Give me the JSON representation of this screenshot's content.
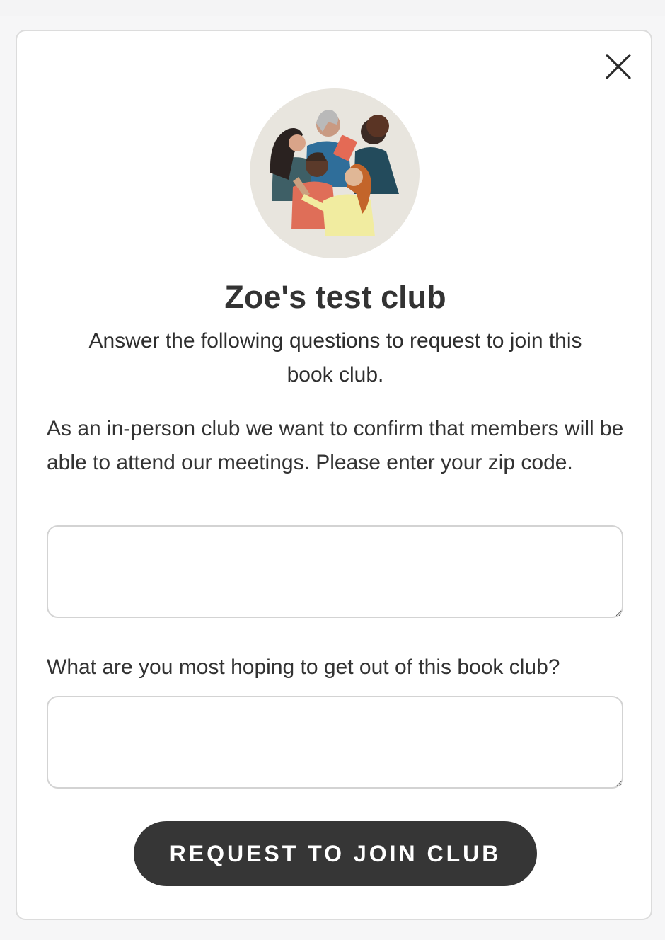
{
  "club": {
    "name": "Zoe's test club",
    "intro": "Answer the following questions to request to join this book club."
  },
  "questions": [
    {
      "text": "As an in-person club we want to confirm that members will be able to attend our meetings. Please enter your zip code.",
      "value": "",
      "placeholder": ""
    },
    {
      "text": "What are you most hoping to get out of this book club?",
      "value": "",
      "placeholder": ""
    }
  ],
  "actions": {
    "submit_label": "REQUEST TO JOIN CLUB",
    "close_icon": "close-icon"
  },
  "colors": {
    "button_bg": "#363636",
    "border": "#d3d3d3",
    "text": "#333333"
  }
}
